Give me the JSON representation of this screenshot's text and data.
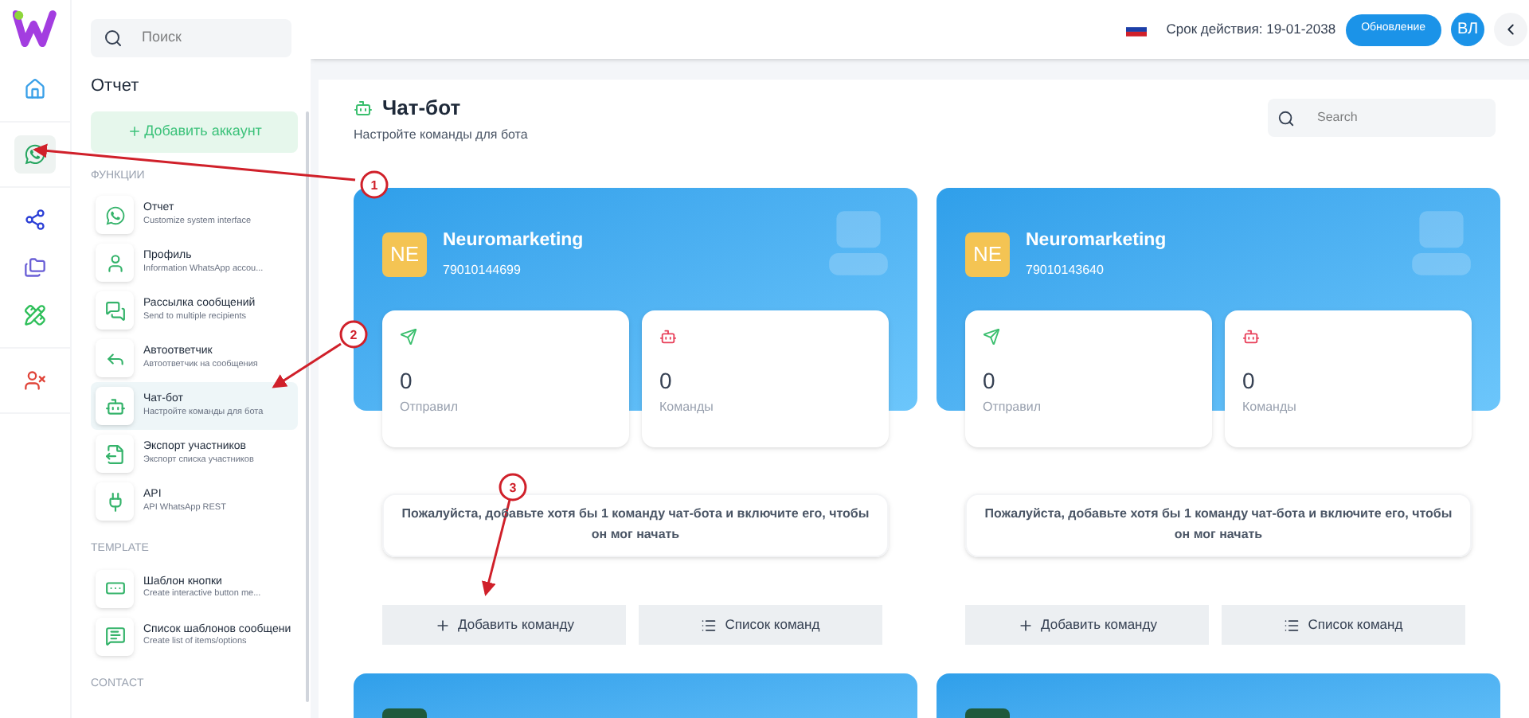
{
  "rail": {
    "items": [
      {
        "kind": "home",
        "selected": false
      },
      {
        "kind": "whatsapp",
        "selected": true
      },
      {
        "kind": "share",
        "selected": false
      },
      {
        "kind": "folders",
        "selected": false
      },
      {
        "kind": "tools",
        "selected": false
      },
      {
        "kind": "user",
        "selected": false
      }
    ]
  },
  "sidebar": {
    "search_placeholder": "Поиск",
    "title": "Отчет",
    "add_account": "Добавить аккаунт",
    "sections": [
      {
        "label": "ФУНКЦИИ",
        "items": [
          {
            "title": "Отчет",
            "subtitle": "Customize system interface",
            "selected": false
          },
          {
            "title": "Профиль",
            "subtitle": "Information WhatsApp accou...",
            "selected": false
          },
          {
            "title": "Рассылка сообщений",
            "subtitle": "Send to multiple recipients",
            "selected": false
          },
          {
            "title": "Автоответчик",
            "subtitle": "Автоответчик на сообщения",
            "selected": false
          },
          {
            "title": "Чат-бот",
            "subtitle": "Настройте команды для бота",
            "selected": true
          },
          {
            "title": "Экспорт участников",
            "subtitle": "Экспорт списка участников",
            "selected": false
          },
          {
            "title": "API",
            "subtitle": "API WhatsApp REST",
            "selected": false
          }
        ]
      },
      {
        "label": "TEMPLATE",
        "items": [
          {
            "title": "Шаблон кнопки",
            "subtitle": "Create interactive button me...",
            "selected": false
          },
          {
            "title": "Список шаблонов сообщени",
            "subtitle": "Create list of items/options",
            "selected": false
          }
        ]
      },
      {
        "label": "CONTACT"
      }
    ]
  },
  "header": {
    "expiry": "Срок действия: 19-01-2038",
    "update_button": "Обновление",
    "avatar": "ВЛ"
  },
  "page": {
    "title": "Чат-бот",
    "subtitle": "Настройте команды для бота",
    "search_placeholder": "Search"
  },
  "bots": [
    {
      "avatar": "NE",
      "name": "Neuromarketing",
      "phone": "79010144699",
      "stats": [
        {
          "kind": "sent",
          "value": "0",
          "label": "Отправил"
        },
        {
          "kind": "commands",
          "value": "0",
          "label": "Команды"
        }
      ],
      "notice": "Пожалуйста, добавьте хотя бы 1 команду чат-бота и включите его, чтобы он мог начать",
      "actions": [
        {
          "kind": "add",
          "label": "Добавить команду"
        },
        {
          "kind": "list",
          "label": "Список команд"
        }
      ]
    },
    {
      "avatar": "NE",
      "name": "Neuromarketing",
      "phone": "79010143640",
      "stats": [
        {
          "kind": "sent",
          "value": "0",
          "label": "Отправил"
        },
        {
          "kind": "commands",
          "value": "0",
          "label": "Команды"
        }
      ],
      "notice": "Пожалуйста, добавьте хотя бы 1 команду чат-бота и включите его, чтобы он мог начать",
      "actions": [
        {
          "kind": "add",
          "label": "Добавить команду"
        },
        {
          "kind": "list",
          "label": "Список команд"
        }
      ]
    }
  ],
  "more_bots": [
    {
      "color": "#1f5a3c"
    },
    {
      "color": "#1f5a3c"
    }
  ],
  "annotations": [
    {
      "label": "1"
    },
    {
      "label": "2"
    },
    {
      "label": "3"
    }
  ]
}
